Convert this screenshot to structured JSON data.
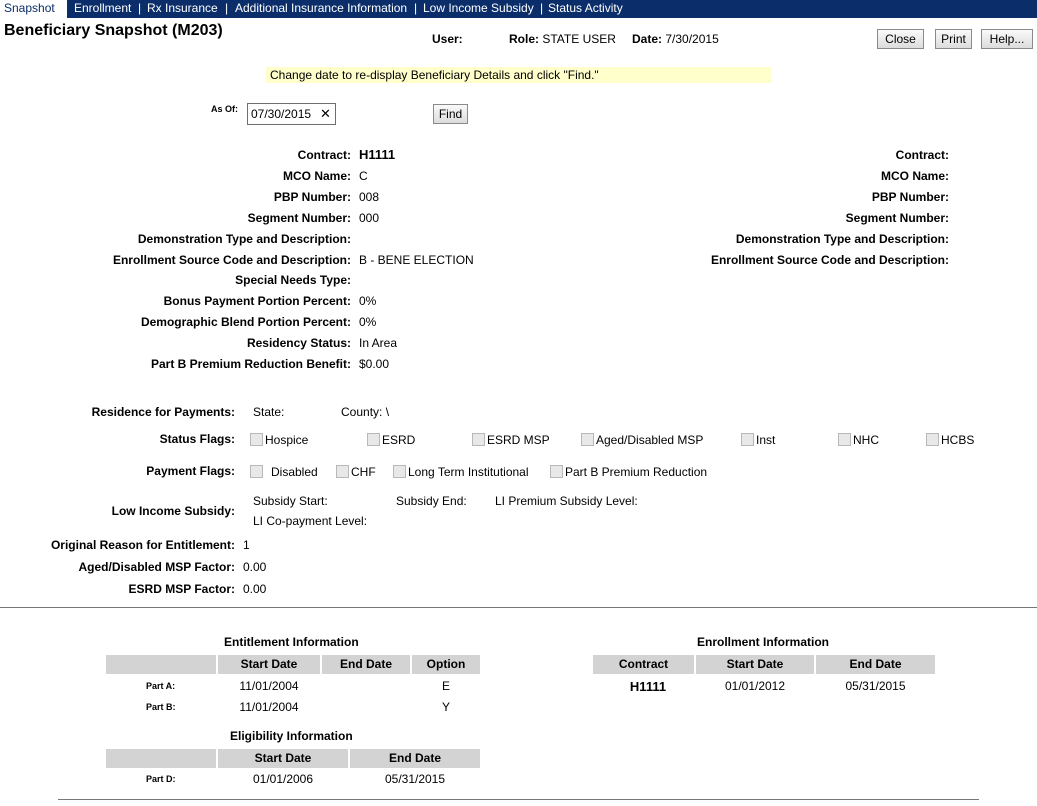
{
  "nav": {
    "tabs": [
      "Snapshot",
      "Enrollment",
      "Rx Insurance",
      "Additional Insurance Information",
      "Low Income Subsidy",
      "Status Activity"
    ]
  },
  "header": {
    "title": "Beneficiary Snapshot (M203)",
    "user_label": "User:",
    "role_text": "Role: STATE USER",
    "date_text": "Date: 7/30/2015",
    "buttons": {
      "close": "Close",
      "print": "Print",
      "help": "Help..."
    }
  },
  "notice": "Change date to re-display Beneficiary Details and click \"Find.\"",
  "asof": {
    "label": "As Of:",
    "value": "07/30/2015",
    "clear": "✕",
    "find": "Find"
  },
  "details_left": [
    {
      "label": "Contract:",
      "value": "H1111"
    },
    {
      "label": "MCO Name:",
      "value": "C"
    },
    {
      "label": "PBP Number:",
      "value": "008"
    },
    {
      "label": "Segment Number:",
      "value": "000"
    },
    {
      "label": "Demonstration Type and Description:",
      "value": ""
    },
    {
      "label": "Enrollment Source Code and Description:",
      "value": "B - BENE ELECTION"
    },
    {
      "label": "Special Needs Type:",
      "value": ""
    },
    {
      "label": "Bonus Payment Portion Percent:",
      "value": "0%"
    },
    {
      "label": "Demographic Blend Portion Percent:",
      "value": "0%"
    },
    {
      "label": "Residency Status:",
      "value": "In Area"
    },
    {
      "label": "Part B Premium Reduction Benefit:",
      "value": "$0.00"
    }
  ],
  "details_right": [
    "Contract:",
    "MCO Name:",
    "PBP Number:",
    "Segment Number:",
    "Demonstration Type and Description:",
    "Enrollment Source Code and Description:"
  ],
  "residence": {
    "label": "Residence for Payments:",
    "state": "State:",
    "county": "County: \\"
  },
  "status_flags": {
    "label": "Status Flags:",
    "items": [
      "Hospice",
      "ESRD",
      "ESRD MSP",
      "Aged/Disabled MSP",
      "Inst",
      "NHC",
      "HCBS"
    ]
  },
  "payment_flags": {
    "label": "Payment Flags:",
    "items": [
      "Disabled",
      "CHF",
      "Long Term Institutional",
      "Part B Premium Reduction"
    ]
  },
  "lis": {
    "label": "Low Income Subsidy:",
    "subsidy_start": "Subsidy Start:",
    "subsidy_end": "Subsidy End:",
    "premium_level": "LI Premium Subsidy Level:",
    "copay_level": "LI Co-payment Level:"
  },
  "misc": [
    {
      "label": "Original Reason for Entitlement:",
      "value": "1"
    },
    {
      "label": "Aged/Disabled MSP Factor:",
      "value": "0.00"
    },
    {
      "label": "ESRD MSP Factor:",
      "value": "0.00"
    }
  ],
  "entitlement": {
    "title": "Entitlement Information",
    "headers": [
      "",
      "Start Date",
      "End Date",
      "Option"
    ],
    "rows": [
      {
        "label": "Part A:",
        "start": "11/01/2004",
        "end": "",
        "option": "E"
      },
      {
        "label": "Part B:",
        "start": "11/01/2004",
        "end": "",
        "option": "Y"
      }
    ]
  },
  "eligibility": {
    "title": "Eligibility Information",
    "headers": [
      "",
      "Start Date",
      "End Date"
    ],
    "rows": [
      {
        "label": "Part D:",
        "start": "01/01/2006",
        "end": "05/31/2015"
      }
    ]
  },
  "enrollment": {
    "title": "Enrollment Information",
    "headers": [
      "Contract",
      "Start Date",
      "End Date"
    ],
    "rows": [
      {
        "contract": "H1111",
        "start": "01/01/2012",
        "end": "05/31/2015"
      }
    ]
  }
}
